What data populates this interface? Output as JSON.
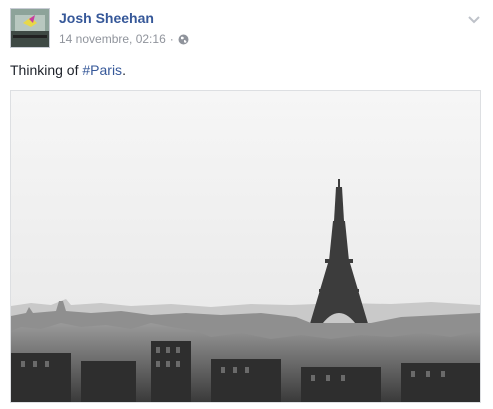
{
  "post": {
    "author": "Josh Sheehan",
    "timestamp": "14 novembre, 02:16",
    "separator": "·",
    "privacy_icon": "globe-icon",
    "menu_icon": "chevron-down-icon",
    "text_prefix": "Thinking of ",
    "hashtag": "#Paris",
    "text_suffix": ".",
    "photo_subject": "eiffel-tower-paris-skyline"
  },
  "colors": {
    "link": "#365899",
    "text": "#1d2129",
    "meta": "#90949c"
  }
}
